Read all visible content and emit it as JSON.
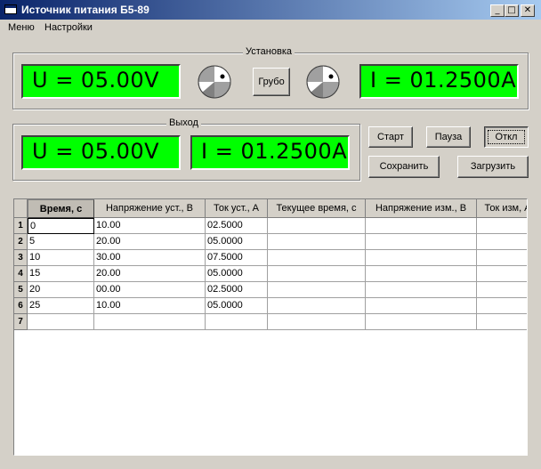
{
  "window": {
    "title": "Источник питания Б5-89",
    "minimize": "_",
    "maximize": "□",
    "close": "✕"
  },
  "menu": [
    "Меню",
    "Настройки"
  ],
  "setup": {
    "label": "Установка",
    "voltage_display": "U = 05.00V",
    "current_display": "I = 01.2500A",
    "coarse_button": "Грубо"
  },
  "output": {
    "label": "Выход",
    "voltage_display": "U = 05.00V",
    "current_display": "I = 01.2500A"
  },
  "controls": {
    "start": "Старт",
    "pause": "Пауза",
    "off": "Откл",
    "save": "Сохранить",
    "load": "Загрузить"
  },
  "table": {
    "columns": [
      "Время, с",
      "Напряжение уст., В",
      "Ток уст., А",
      "Текущее время, с",
      "Напряжение изм., В",
      "Ток изм, А"
    ],
    "row_numbers": [
      "1",
      "2",
      "3",
      "4",
      "5",
      "6",
      "7"
    ],
    "rows": [
      [
        "0",
        "10.00",
        "02.5000",
        "",
        "",
        ""
      ],
      [
        "5",
        "20.00",
        "05.0000",
        "",
        "",
        ""
      ],
      [
        "10",
        "30.00",
        "07.5000",
        "",
        "",
        ""
      ],
      [
        "15",
        "20.00",
        "05.0000",
        "",
        "",
        ""
      ],
      [
        "20",
        "00.00",
        "02.5000",
        "",
        "",
        ""
      ],
      [
        "25",
        "10.00",
        "05.0000",
        "",
        "",
        ""
      ],
      [
        "",
        "",
        "",
        "",
        "",
        ""
      ]
    ]
  },
  "colors": {
    "lcd": "#00ff00",
    "titlebar_start": "#0a246a",
    "titlebar_end": "#a6caf0",
    "window_bg": "#d4d0c8"
  }
}
